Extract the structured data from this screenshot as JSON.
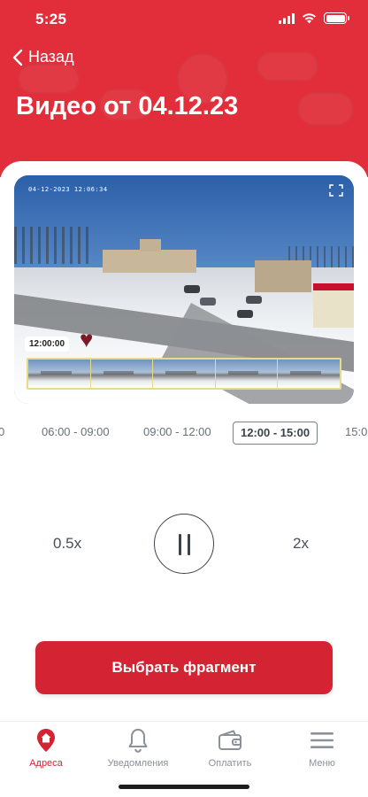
{
  "status": {
    "time": "5:25"
  },
  "header": {
    "back_label": "Назад",
    "title": "Видео от 04.12.23"
  },
  "video": {
    "timestamp": "04-12-2023 12:06:34",
    "current_time_badge": "12:00:00",
    "thumbnail_count": 5
  },
  "time_ranges": [
    "0",
    "06:00 - 09:00",
    "09:00 - 12:00",
    "12:00 - 15:00",
    "15:0"
  ],
  "active_range": "12:00 - 15:00",
  "controls": {
    "slow_speed": "0.5x",
    "fast_speed": "2x"
  },
  "cta": {
    "label": "Выбрать фрагмент"
  },
  "tabs": [
    {
      "label": "Адреса",
      "icon": "address-pin-icon",
      "active": true
    },
    {
      "label": "Уведомления",
      "icon": "bell-icon",
      "active": false
    },
    {
      "label": "Оплатить",
      "icon": "wallet-icon",
      "active": false
    },
    {
      "label": "Меню",
      "icon": "menu-icon",
      "active": false
    }
  ],
  "colors": {
    "brand_red": "#e12e3a",
    "button_red": "#d42333",
    "text_gray": "#6a6f78"
  }
}
